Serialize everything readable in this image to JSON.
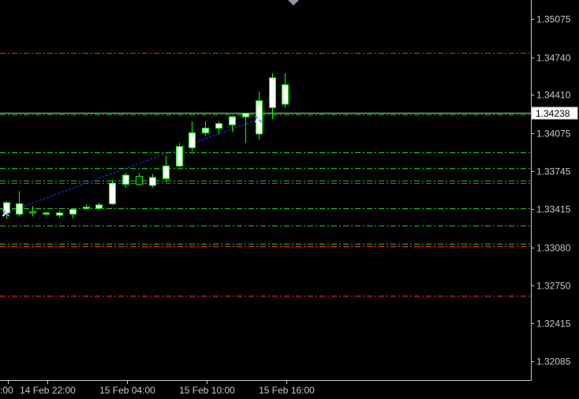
{
  "chart_data": {
    "type": "candlestick",
    "title": "",
    "xlabel": "",
    "ylabel": "",
    "ylim": [
      1.3192,
      1.3524
    ],
    "grid": false,
    "colors": {
      "background": "#000000",
      "bull_candle_body": "#ffffff",
      "bear_candle_body": "#000000",
      "candle_outline": "#00ff00",
      "axis": "#c8c8c8",
      "trend_line": "#1e32ff",
      "level_red": "#ff2020",
      "level_green": "#14c814",
      "current_price_line": "#c0c0c0",
      "arrow_marker": "#8888ff"
    },
    "y_ticks": [
      1.35075,
      1.3474,
      1.3441,
      1.34075,
      1.33745,
      1.33415,
      1.3308,
      1.3275,
      1.32415,
      1.32085
    ],
    "y_tick_labels": [
      "1.35075",
      "1.34740",
      "1.34410",
      "1.34075",
      "1.33745",
      "1.33415",
      "1.33080",
      "1.32750",
      "1.32415",
      "1.32085"
    ],
    "x_tick_labels": [
      ":00",
      "14 Feb 22:00",
      "15 Feb 04:00",
      "15 Feb 10:00",
      "15 Feb 16:00"
    ],
    "x_tick_bar_index": [
      0,
      3,
      9,
      15,
      21
    ],
    "current_price": 1.34238,
    "current_price_label": "1.34238",
    "horizontal_levels": [
      {
        "price": 1.34778,
        "color": "red"
      },
      {
        "price": 1.34238,
        "color": "green"
      },
      {
        "price": 1.3391,
        "color": "green"
      },
      {
        "price": 1.3377,
        "color": "green"
      },
      {
        "price": 1.3366,
        "color": "green"
      },
      {
        "price": 1.3364,
        "color": "red"
      },
      {
        "price": 1.3342,
        "color": "green"
      },
      {
        "price": 1.3327,
        "color": "green"
      },
      {
        "price": 1.3311,
        "color": "green"
      },
      {
        "price": 1.3309,
        "color": "red"
      },
      {
        "price": 1.3266,
        "color": "red"
      }
    ],
    "trend_line": {
      "from": {
        "bar": 0,
        "price": 1.3338
      },
      "to": {
        "bar": 19,
        "price": 1.342
      }
    },
    "candles": [
      {
        "open": 1.3338,
        "high": 1.3348,
        "low": 1.3333,
        "close": 1.3347
      },
      {
        "open": 1.3337,
        "high": 1.3357,
        "low": 1.3335,
        "close": 1.3346
      },
      {
        "open": 1.3339,
        "high": 1.3344,
        "low": 1.3335,
        "close": 1.3338
      },
      {
        "open": 1.3337,
        "high": 1.3339,
        "low": 1.3336,
        "close": 1.3338
      },
      {
        "open": 1.3336,
        "high": 1.334,
        "low": 1.3334,
        "close": 1.3338
      },
      {
        "open": 1.3337,
        "high": 1.3342,
        "low": 1.3333,
        "close": 1.3341
      },
      {
        "open": 1.3342,
        "high": 1.3345,
        "low": 1.3341,
        "close": 1.3343
      },
      {
        "open": 1.3342,
        "high": 1.3347,
        "low": 1.3341,
        "close": 1.3345
      },
      {
        "open": 1.3346,
        "high": 1.3367,
        "low": 1.3345,
        "close": 1.3364
      },
      {
        "open": 1.3363,
        "high": 1.3373,
        "low": 1.336,
        "close": 1.3371
      },
      {
        "open": 1.337,
        "high": 1.3373,
        "low": 1.3362,
        "close": 1.3363
      },
      {
        "open": 1.3362,
        "high": 1.3372,
        "low": 1.336,
        "close": 1.3369
      },
      {
        "open": 1.3368,
        "high": 1.3388,
        "low": 1.3365,
        "close": 1.3379
      },
      {
        "open": 1.3379,
        "high": 1.3399,
        "low": 1.3378,
        "close": 1.3396
      },
      {
        "open": 1.3395,
        "high": 1.3418,
        "low": 1.3392,
        "close": 1.3408
      },
      {
        "open": 1.3408,
        "high": 1.3418,
        "low": 1.3405,
        "close": 1.3412
      },
      {
        "open": 1.3412,
        "high": 1.3418,
        "low": 1.3407,
        "close": 1.3416
      },
      {
        "open": 1.3415,
        "high": 1.3423,
        "low": 1.3409,
        "close": 1.3422
      },
      {
        "open": 1.3422,
        "high": 1.3425,
        "low": 1.3399,
        "close": 1.3425
      },
      {
        "open": 1.3407,
        "high": 1.3444,
        "low": 1.3402,
        "close": 1.3436
      },
      {
        "open": 1.343,
        "high": 1.346,
        "low": 1.342,
        "close": 1.3456
      },
      {
        "open": 1.3433,
        "high": 1.346,
        "low": 1.343,
        "close": 1.345
      }
    ]
  }
}
